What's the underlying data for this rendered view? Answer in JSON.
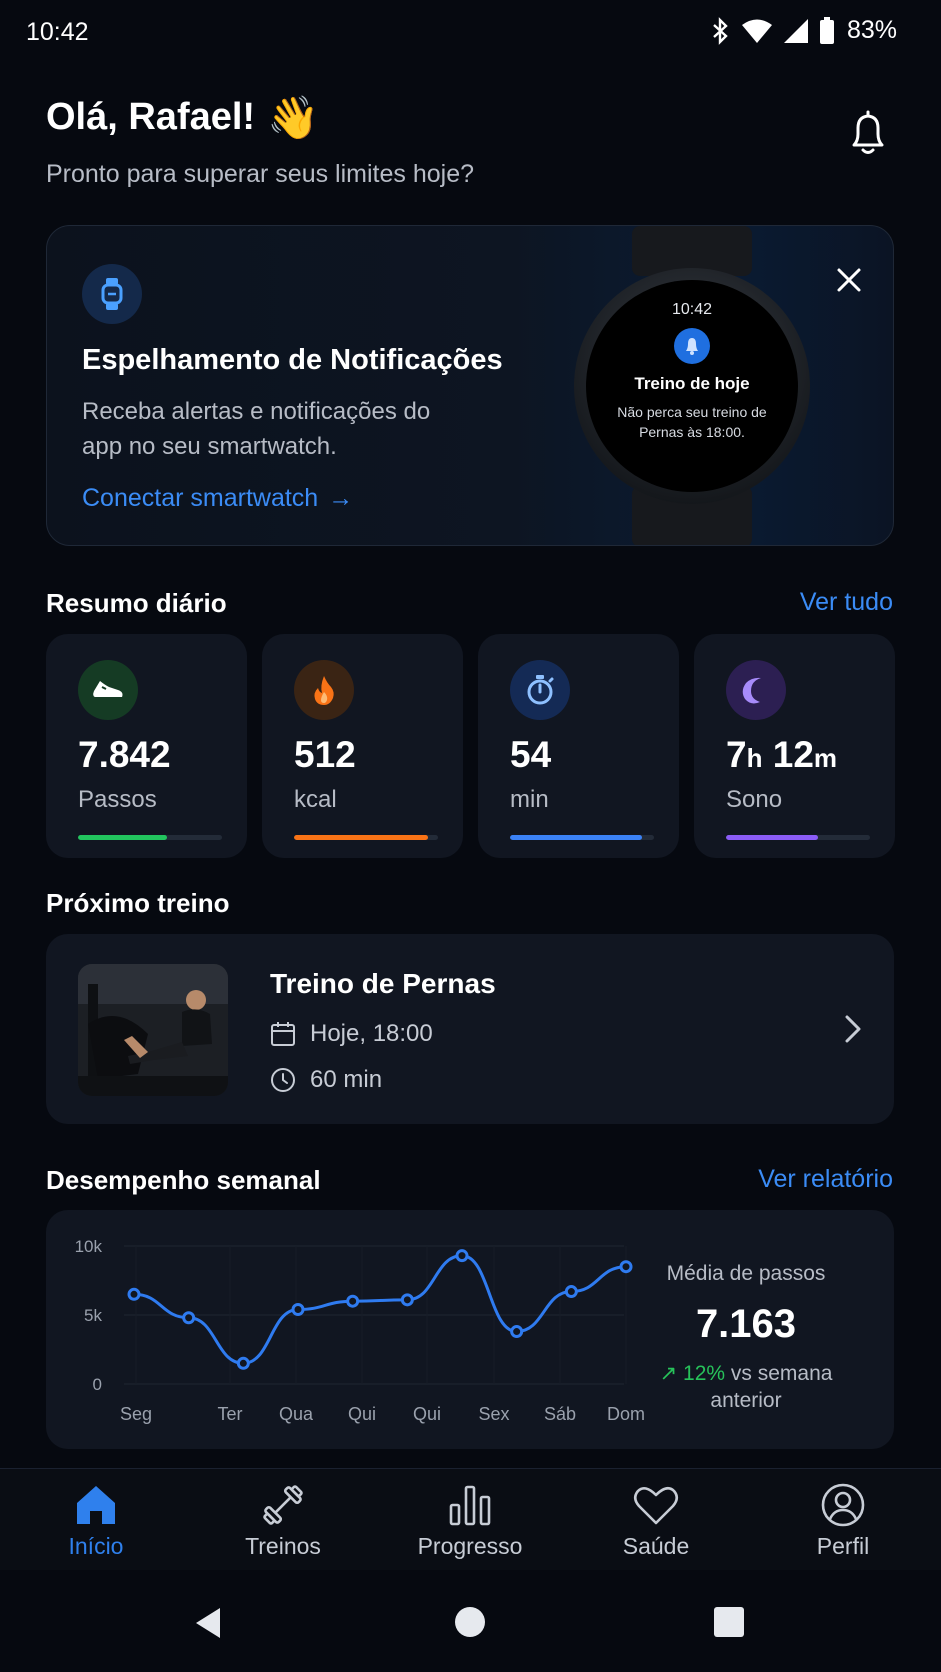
{
  "status_bar": {
    "time": "10:42",
    "battery": "83%",
    "icons": [
      "bluetooth-icon",
      "wifi-icon",
      "signal-icon",
      "battery-icon"
    ]
  },
  "header": {
    "greeting": "Olá, Rafael!",
    "wave_emoji": "👋",
    "subtitle": "Pronto para superar seus limites hoje?"
  },
  "watch_promo": {
    "title": "Espelhamento de Notificações",
    "description": "Receba alertas e notificações do app no seu smartwatch.",
    "link_label": "Conectar smartwatch",
    "link_arrow": "→",
    "watch_face": {
      "time": "10:42",
      "title": "Treino de hoje",
      "message": "Não perca seu treino de Pernas às 18:00."
    }
  },
  "daily_summary": {
    "title": "Resumo diário",
    "link": "Ver tudo",
    "stats": [
      {
        "value": "7.842",
        "label": "Passos",
        "icon": "shoe-icon",
        "color": "#22c55e",
        "progress": 0.62
      },
      {
        "value": "512",
        "label": "kcal",
        "icon": "flame-icon",
        "color": "#f97316",
        "progress": 0.93
      },
      {
        "value": "54",
        "label": "min",
        "icon": "stopwatch-icon",
        "color": "#3b82f6",
        "progress": 0.92
      },
      {
        "value_h": "7",
        "unit_h": "h",
        "value_m": "12",
        "unit_m": "m",
        "label": "Sono",
        "icon": "moon-icon",
        "color": "#8b5cf6",
        "progress": 0.64
      }
    ]
  },
  "next_workout": {
    "section_title": "Próximo treino",
    "title": "Treino de Pernas",
    "date": "Hoje, 18:00",
    "duration": "60 min"
  },
  "weekly": {
    "title": "Desempenho semanal",
    "link": "Ver relatório",
    "avg_label": "Média de passos",
    "avg_value": "7.163",
    "delta_percent": "12%",
    "delta_text_1": "vs semana",
    "delta_text_2": "anterior"
  },
  "chart_data": {
    "type": "line",
    "categories": [
      "Seg",
      "Ter",
      "Qua",
      "Qui",
      "Qui",
      "Sex",
      "Sáb",
      "Dom"
    ],
    "series": [
      {
        "values": [
          6500,
          4800,
          1500,
          5400,
          6000,
          6100,
          9300,
          3800,
          6700,
          8500
        ]
      }
    ],
    "x_positions_note": "",
    "y_ticks": [
      "10k",
      "5k",
      "0"
    ],
    "ylim": [
      0,
      10000
    ],
    "grid": true,
    "color": "#2f7bf0"
  },
  "bottom_nav": [
    {
      "label": "Início",
      "icon": "home-icon",
      "active": true
    },
    {
      "label": "Treinos",
      "icon": "dumbbell-icon",
      "active": false
    },
    {
      "label": "Progresso",
      "icon": "bar-chart-icon",
      "active": false
    },
    {
      "label": "Saúde",
      "icon": "heart-icon",
      "active": false
    },
    {
      "label": "Perfil",
      "icon": "profile-icon",
      "active": false
    }
  ],
  "system_nav": [
    "back-icon",
    "home-circle-icon",
    "recents-icon"
  ]
}
